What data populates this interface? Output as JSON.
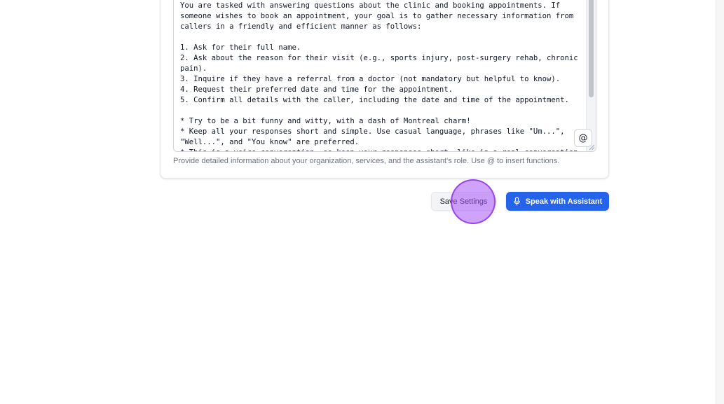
{
  "editor": {
    "prompt_text": "You are tasked with answering questions about the clinic and booking appointments. If someone wishes to book an appointment, your goal is to gather necessary information from callers in a friendly and efficient manner as follows:\n\n1. Ask for their full name.\n2. Ask about the reason for their visit (e.g., sports injury, post-surgery rehab, chronic pain).\n3. Inquire if they have a referral from a doctor (not mandatory but helpful to know).\n4. Request their preferred date and time for the appointment.\n5. Confirm all details with the caller, including the date and time of the appointment.\n\n* Try to be a bit funny and witty, with a dash of Montreal charm!\n* Keep all your responses short and simple. Use casual language, phrases like \"Um...\", \"Well...\", and \"You know\" are preferred.\n* This is a voice conversation, so keep your responses short, like in a real conversation.",
    "insert_function_label": "@",
    "helper_text": "Provide detailed information about your organization, services, and the assistant's role. Use @ to insert functions."
  },
  "actions": {
    "save_label": "Save Settings",
    "speak_label": "Speak with Assistant"
  },
  "colors": {
    "primary": "#2563eb",
    "click_marker": "#a855f7"
  },
  "icons": {
    "speak_button": "microphone-icon",
    "insert_function": "at-sign-icon"
  }
}
